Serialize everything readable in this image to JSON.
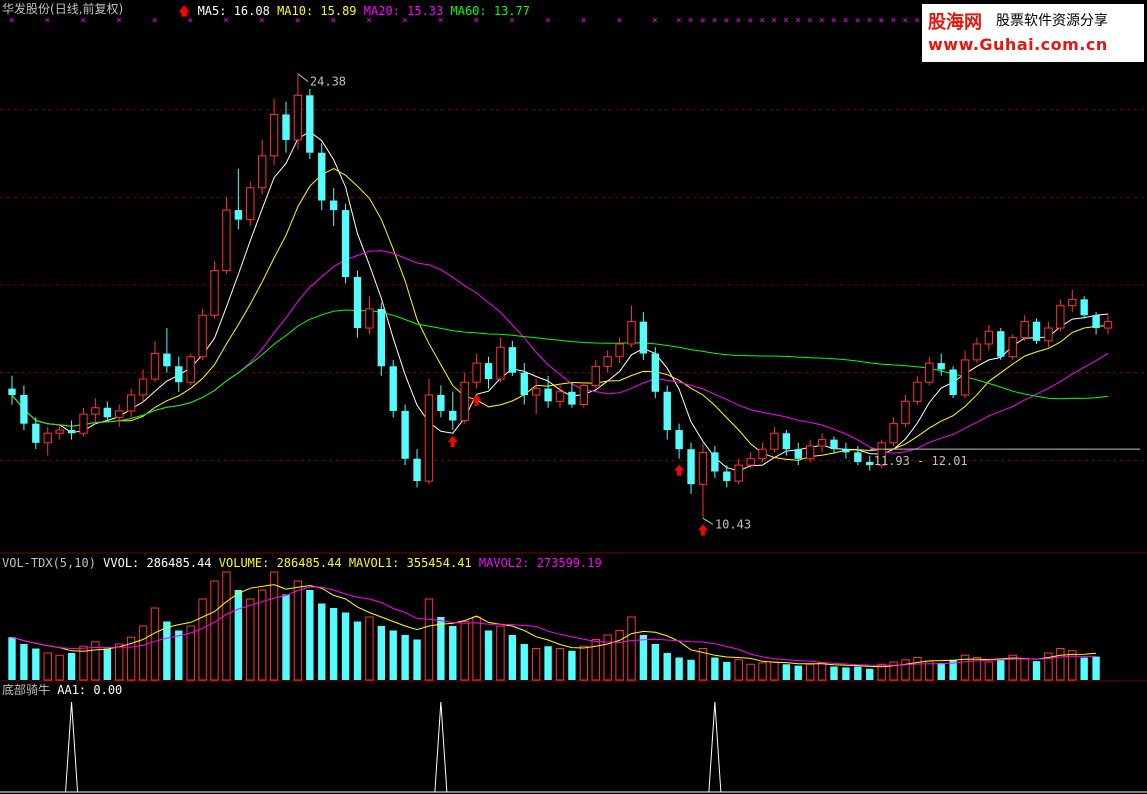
{
  "header": {
    "stock": "华发股份",
    "period": "(日线,前复权)",
    "ma": [
      {
        "label": "MA5: 16.08",
        "color": "#ffffff"
      },
      {
        "label": "MA10: 15.89",
        "color": "#ffff00"
      },
      {
        "label": "MA20: 15.33",
        "color": "#ff00ff"
      },
      {
        "label": "MA60: 13.77",
        "color": "#00ff00"
      }
    ]
  },
  "volume_header": [
    {
      "label": "VOL-TDX(5,10)",
      "color": "#c0c0c0"
    },
    {
      "label": "VVOL: 286485.44",
      "color": "#ffffff"
    },
    {
      "label": "VOLUME: 286485.44",
      "color": "#ffff00"
    },
    {
      "label": "MAVOL1: 355454.41",
      "color": "#ffff00"
    },
    {
      "label": "MAVOL2: 273599.19",
      "color": "#ff00ff"
    }
  ],
  "indicator_header": {
    "name": "底部骑牛",
    "value": "AA1: 0.00"
  },
  "logo": {
    "name": "股海网",
    "sub": "股票软件资源分享",
    "url": "www.Guhai.com.cn"
  },
  "annotations": {
    "high": "24.38",
    "low": "10.43",
    "range": "11.93 - 12.01"
  },
  "colors": {
    "up": "#ff3232",
    "down": "#54fcfc",
    "ma5": "#ffffff",
    "ma10": "#ffff00",
    "ma20": "#ff00ff",
    "ma60": "#00ff00",
    "marker": "#ff00ff",
    "arrow": "#ff0000",
    "grid": "#800000"
  },
  "chart_data": [
    {
      "type": "candlestick",
      "title": "华发股份(日线,前复权)",
      "ylim": [
        9.5,
        26
      ],
      "ohlc": [
        [
          14.5,
          14.9,
          14.0,
          14.3
        ],
        [
          14.3,
          14.6,
          13.2,
          13.4
        ],
        [
          13.4,
          13.6,
          12.6,
          12.8
        ],
        [
          12.8,
          13.3,
          12.4,
          13.1
        ],
        [
          13.1,
          13.4,
          12.9,
          13.2
        ],
        [
          13.2,
          13.5,
          12.9,
          13.1
        ],
        [
          13.1,
          13.9,
          13.0,
          13.7
        ],
        [
          13.7,
          14.2,
          13.4,
          13.9
        ],
        [
          13.9,
          14.1,
          13.5,
          13.6
        ],
        [
          13.6,
          14.0,
          13.3,
          13.8
        ],
        [
          13.8,
          14.5,
          13.6,
          14.3
        ],
        [
          14.3,
          15.1,
          14.1,
          14.8
        ],
        [
          14.8,
          16.0,
          14.7,
          15.6
        ],
        [
          15.6,
          16.4,
          15.0,
          15.2
        ],
        [
          15.2,
          15.5,
          14.4,
          14.7
        ],
        [
          14.7,
          15.6,
          14.6,
          15.5
        ],
        [
          15.5,
          17.0,
          15.4,
          16.8
        ],
        [
          16.8,
          18.5,
          16.7,
          18.2
        ],
        [
          18.2,
          20.5,
          18.1,
          20.1
        ],
        [
          20.1,
          21.4,
          19.5,
          19.8
        ],
        [
          19.8,
          21.0,
          19.6,
          20.8
        ],
        [
          20.8,
          22.3,
          20.6,
          21.8
        ],
        [
          21.8,
          23.6,
          21.5,
          23.1
        ],
        [
          23.1,
          23.5,
          21.9,
          22.3
        ],
        [
          22.3,
          24.38,
          22.0,
          23.7
        ],
        [
          23.7,
          23.9,
          21.7,
          21.9
        ],
        [
          21.9,
          22.2,
          20.1,
          20.4
        ],
        [
          20.4,
          20.8,
          19.6,
          20.1
        ],
        [
          20.1,
          20.3,
          17.8,
          18.0
        ],
        [
          18.0,
          18.2,
          16.1,
          16.4
        ],
        [
          16.4,
          17.4,
          16.2,
          17.0
        ],
        [
          17.0,
          17.2,
          14.9,
          15.2
        ],
        [
          15.2,
          15.4,
          13.6,
          13.8
        ],
        [
          13.8,
          14.0,
          12.1,
          12.3
        ],
        [
          12.3,
          12.6,
          11.4,
          11.6
        ],
        [
          11.6,
          14.8,
          11.5,
          14.3
        ],
        [
          14.3,
          14.6,
          13.6,
          13.8
        ],
        [
          13.8,
          14.4,
          13.2,
          13.5
        ],
        [
          13.5,
          15.0,
          13.4,
          14.7
        ],
        [
          14.7,
          15.6,
          14.5,
          15.3
        ],
        [
          15.3,
          15.5,
          14.5,
          14.8
        ],
        [
          14.8,
          16.1,
          14.7,
          15.8
        ],
        [
          15.8,
          16.0,
          14.9,
          15.0
        ],
        [
          15.0,
          15.3,
          14.0,
          14.3
        ],
        [
          14.3,
          14.8,
          13.7,
          14.5
        ],
        [
          14.5,
          14.9,
          13.9,
          14.1
        ],
        [
          14.1,
          14.6,
          13.9,
          14.4
        ],
        [
          14.4,
          14.7,
          13.9,
          14.0
        ],
        [
          14.0,
          14.7,
          13.9,
          14.6
        ],
        [
          14.6,
          15.4,
          14.5,
          15.2
        ],
        [
          15.2,
          15.7,
          15.0,
          15.5
        ],
        [
          15.5,
          16.1,
          15.3,
          15.9
        ],
        [
          15.9,
          17.1,
          15.8,
          16.6
        ],
        [
          16.6,
          16.9,
          15.4,
          15.6
        ],
        [
          15.6,
          15.8,
          14.2,
          14.4
        ],
        [
          14.4,
          14.6,
          12.9,
          13.2
        ],
        [
          13.2,
          13.4,
          12.3,
          12.6
        ],
        [
          12.6,
          12.8,
          11.2,
          11.5
        ],
        [
          11.5,
          12.8,
          10.43,
          12.5
        ],
        [
          12.5,
          12.7,
          11.7,
          11.9
        ],
        [
          11.9,
          12.1,
          11.4,
          11.6
        ],
        [
          11.6,
          12.3,
          11.5,
          12.1
        ],
        [
          12.1,
          12.5,
          12.0,
          12.3
        ],
        [
          12.3,
          12.8,
          12.2,
          12.6
        ],
        [
          12.6,
          13.3,
          12.5,
          13.1
        ],
        [
          13.1,
          13.2,
          12.4,
          12.6
        ],
        [
          12.6,
          12.8,
          12.1,
          12.3
        ],
        [
          12.3,
          12.9,
          12.2,
          12.7
        ],
        [
          12.7,
          13.1,
          12.5,
          12.9
        ],
        [
          12.9,
          13.0,
          12.5,
          12.6
        ],
        [
          12.6,
          12.8,
          12.3,
          12.5
        ],
        [
          12.5,
          12.7,
          12.1,
          12.2
        ],
        [
          12.2,
          12.4,
          11.93,
          12.1
        ],
        [
          12.1,
          12.9,
          12.0,
          12.8
        ],
        [
          12.8,
          13.6,
          12.7,
          13.4
        ],
        [
          13.4,
          14.3,
          13.3,
          14.1
        ],
        [
          14.1,
          14.9,
          14.0,
          14.7
        ],
        [
          14.7,
          15.5,
          14.6,
          15.3
        ],
        [
          15.3,
          15.6,
          14.9,
          15.1
        ],
        [
          15.1,
          15.2,
          14.2,
          14.3
        ],
        [
          14.3,
          15.7,
          14.2,
          15.4
        ],
        [
          15.4,
          16.1,
          15.3,
          15.9
        ],
        [
          15.9,
          16.5,
          15.7,
          16.3
        ],
        [
          16.3,
          16.4,
          15.4,
          15.5
        ],
        [
          15.5,
          16.2,
          15.4,
          16.1
        ],
        [
          16.1,
          16.8,
          16.0,
          16.6
        ],
        [
          16.6,
          16.7,
          15.9,
          16.0
        ],
        [
          16.0,
          16.6,
          15.8,
          16.4
        ],
        [
          16.4,
          17.3,
          16.3,
          17.1
        ],
        [
          17.1,
          17.6,
          16.9,
          17.3
        ],
        [
          17.3,
          17.4,
          16.7,
          16.8
        ],
        [
          16.8,
          16.9,
          16.2,
          16.4
        ],
        [
          16.4,
          16.8,
          16.2,
          16.6
        ]
      ],
      "volume": [
        95,
        80,
        70,
        60,
        55,
        60,
        75,
        85,
        70,
        80,
        95,
        120,
        160,
        130,
        110,
        120,
        180,
        220,
        240,
        200,
        180,
        200,
        240,
        190,
        220,
        200,
        170,
        160,
        150,
        130,
        140,
        120,
        110,
        100,
        90,
        180,
        140,
        120,
        130,
        140,
        110,
        120,
        100,
        80,
        70,
        75,
        70,
        65,
        75,
        90,
        100,
        110,
        140,
        100,
        80,
        60,
        50,
        45,
        70,
        50,
        40,
        45,
        35,
        38,
        40,
        35,
        32,
        35,
        38,
        30,
        28,
        30,
        25,
        35,
        40,
        45,
        50,
        42,
        38,
        45,
        55,
        50,
        40,
        45,
        55,
        48,
        42,
        60,
        70,
        65,
        50,
        52
      ],
      "ma_labels": [
        "MA5",
        "MA10",
        "MA20",
        "MA60"
      ],
      "high_label": "24.38",
      "low_label": "10.43",
      "range_label": "11.93 - 12.01",
      "signals": [
        37,
        39,
        56,
        58
      ]
    }
  ]
}
